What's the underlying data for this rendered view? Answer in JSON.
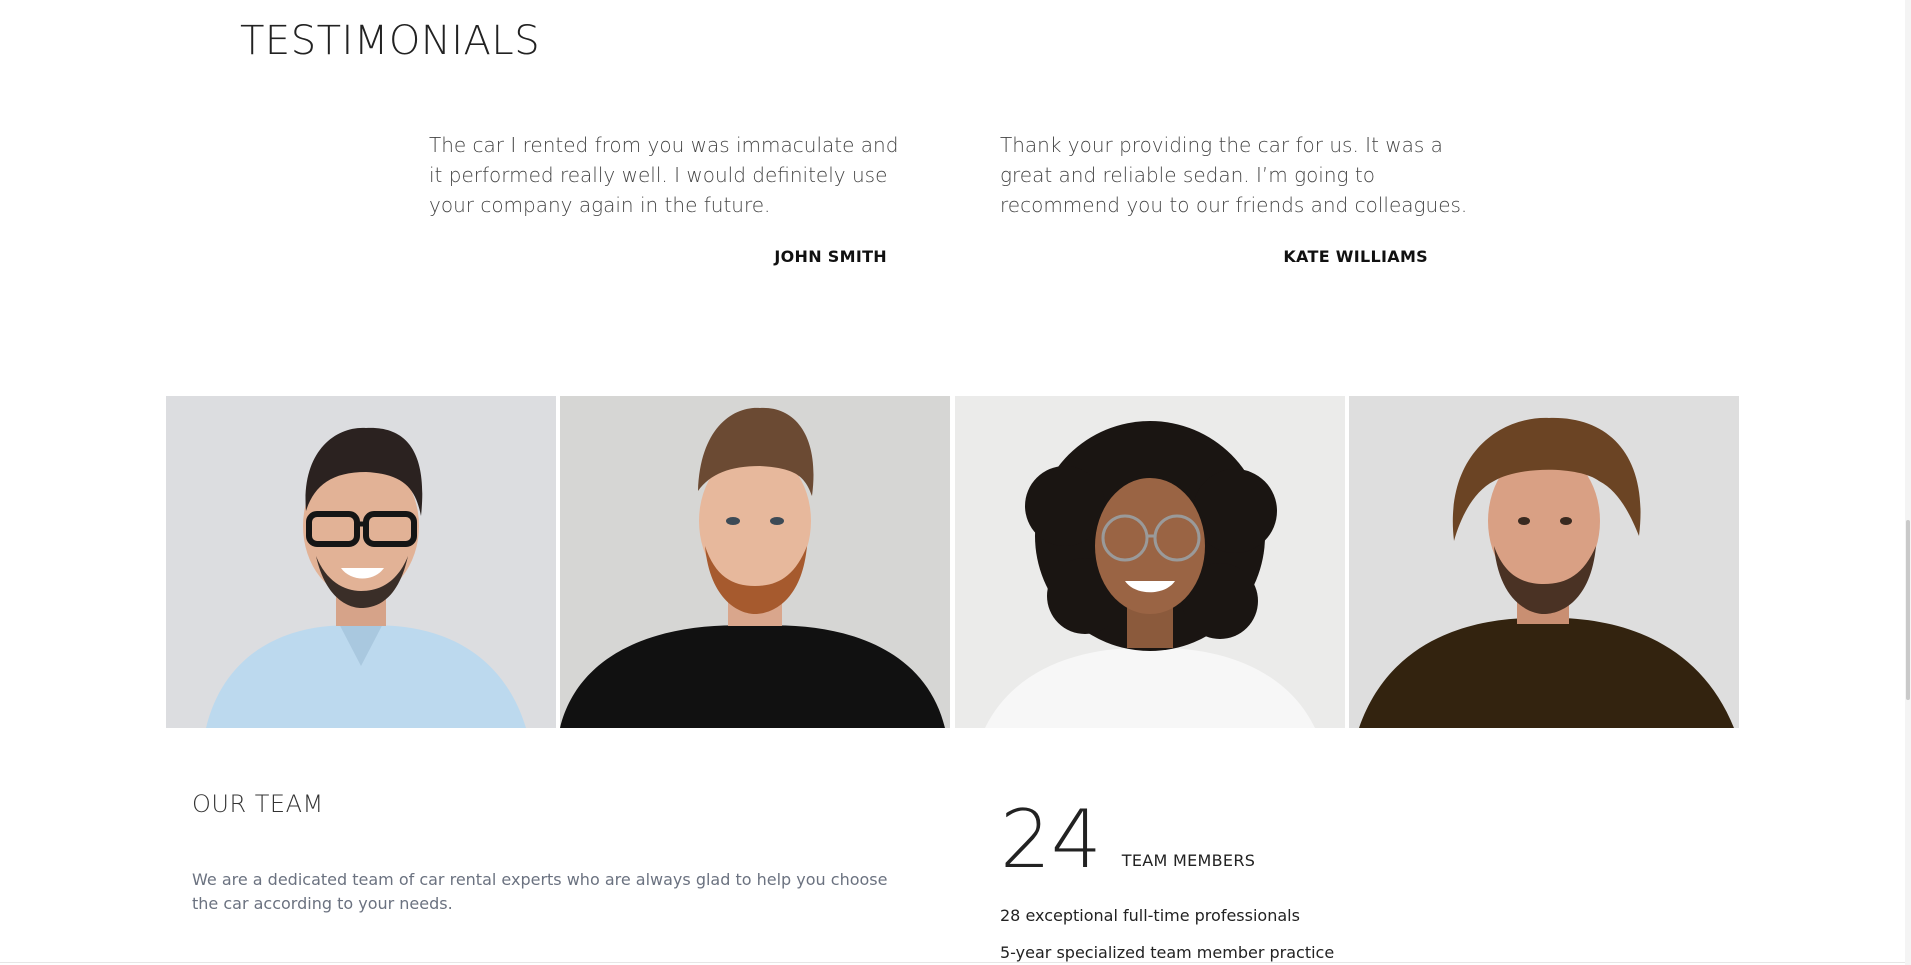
{
  "testimonials": {
    "title": "TESTIMONIALS",
    "items": [
      {
        "quote": "The car I rented from you was immaculate and it performed really well. I would definitely use your company again in the future.",
        "author": "JOHN SMITH"
      },
      {
        "quote": "Thank your providing the car for us. It was a great and reliable sedan. I’m going to recommend you to our friends and colleagues.",
        "author": "KATE WILLIAMS"
      }
    ]
  },
  "team_photos": [
    {
      "icon": "portrait-man-glasses-blue-shirt"
    },
    {
      "icon": "portrait-man-beard-black-shirt"
    },
    {
      "icon": "portrait-woman-curly-hair-glasses"
    },
    {
      "icon": "portrait-man-long-hair-brown-shirt"
    }
  ],
  "team": {
    "title": "OUR TEAM",
    "description": "We are a dedicated team of car rental experts who are always glad to help you choose the car according to your needs."
  },
  "stats": {
    "number": "24",
    "label": "TEAM MEMBERS",
    "lines": [
      "28 exceptional full-time professionals",
      "5-year specialized team member practice"
    ]
  },
  "colors": {
    "text_dark": "#222222",
    "text_muted": "#6b7280",
    "photo_bg_gray": "#dcdde0"
  }
}
